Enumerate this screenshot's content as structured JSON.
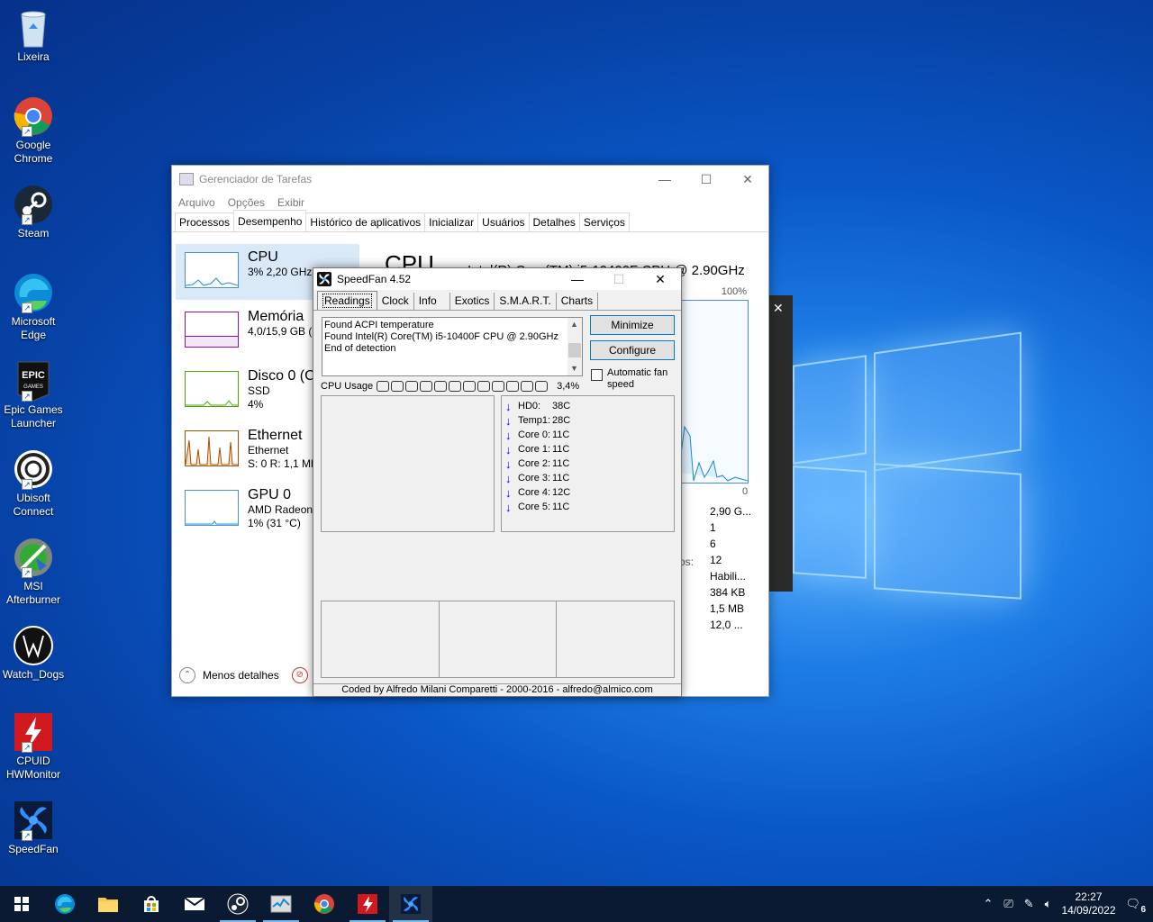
{
  "desktop": {
    "icons": [
      {
        "label": "Lixeira",
        "icon": "recycle-bin-icon"
      },
      {
        "label": "Google Chrome",
        "icon": "chrome-icon"
      },
      {
        "label": "Steam",
        "icon": "steam-icon"
      },
      {
        "label": "Microsoft Edge",
        "icon": "edge-icon"
      },
      {
        "label": "Epic Games Launcher",
        "icon": "epic-games-icon"
      },
      {
        "label": "Ubisoft Connect",
        "icon": "ubisoft-icon"
      },
      {
        "label": "MSI Afterburner",
        "icon": "msi-afterburner-icon"
      },
      {
        "label": "Watch_Dogs",
        "icon": "watch-dogs-icon"
      },
      {
        "label": "CPUID HWMonitor",
        "icon": "hwmonitor-icon"
      },
      {
        "label": "SpeedFan",
        "icon": "speedfan-icon"
      }
    ]
  },
  "taskmgr": {
    "title": "Gerenciador de Tarefas",
    "menu": [
      "Arquivo",
      "Opções",
      "Exibir"
    ],
    "tabs": [
      "Processos",
      "Desempenho",
      "Histórico de aplicativos",
      "Inicializar",
      "Usuários",
      "Detalhes",
      "Serviços"
    ],
    "active_tab": "Desempenho",
    "side": [
      {
        "name": "CPU",
        "line1": "3% 2,20 GHz",
        "line2": ""
      },
      {
        "name": "Memória",
        "line1": "4,0/15,9 GB (2",
        "line2": ""
      },
      {
        "name": "Disco 0 (C:",
        "line1": "SSD",
        "line2": "4%"
      },
      {
        "name": "Ethernet",
        "line1": "Ethernet",
        "line2": "S: 0 R: 1,1 Mb"
      },
      {
        "name": "GPU 0",
        "line1": "AMD Radeon",
        "line2": "1% (31 °C)"
      }
    ],
    "main_title": "CPU",
    "cpu_name": "Intel(R) Core(TM) i5-10400F CPU @ 2.90GHz",
    "pct_max": "100%",
    "pct_min": "0",
    "stats": [
      "2,90 G...",
      "1",
      "6",
      "12",
      "Habili...",
      "384 KB",
      "1,5 MB",
      "12,0 ..."
    ],
    "stat_partial_label": "os:",
    "fewer_details": "Menos detalhes",
    "colors": {
      "cpu": "#1a8ad4",
      "memory": "#8b12ae",
      "disk": "#4da60c",
      "ethernet": "#a74f01",
      "gpu": "#1a8ad4"
    }
  },
  "speedfan": {
    "title": "SpeedFan 4.52",
    "tabs": [
      "Readings",
      "Clock",
      "Info",
      "Exotics",
      "S.M.A.R.T.",
      "Charts"
    ],
    "log": [
      "Found ACPI temperature",
      "Found Intel(R) Core(TM) i5-10400F CPU @ 2.90GHz",
      "End of detection"
    ],
    "minimize_label": "Minimize",
    "configure_label": "Configure",
    "auto_fan_label": "Automatic fan speed",
    "cpu_usage_label": "CPU Usage",
    "cpu_usage_value": "3,4%",
    "readings": [
      {
        "label": "HD0:",
        "value": "38C"
      },
      {
        "label": "Temp1:",
        "value": "28C"
      },
      {
        "label": "Core 0:",
        "value": "11C"
      },
      {
        "label": "Core 1:",
        "value": "11C"
      },
      {
        "label": "Core 2:",
        "value": "11C"
      },
      {
        "label": "Core 3:",
        "value": "11C"
      },
      {
        "label": "Core 4:",
        "value": "12C"
      },
      {
        "label": "Core 5:",
        "value": "11C"
      }
    ],
    "footer": "Coded by Alfredo Milani Comparetti - 2000-2016 - alfredo@almico.com"
  },
  "taskbar": {
    "time": "22:27",
    "date": "14/09/2022",
    "notifications": "6"
  }
}
